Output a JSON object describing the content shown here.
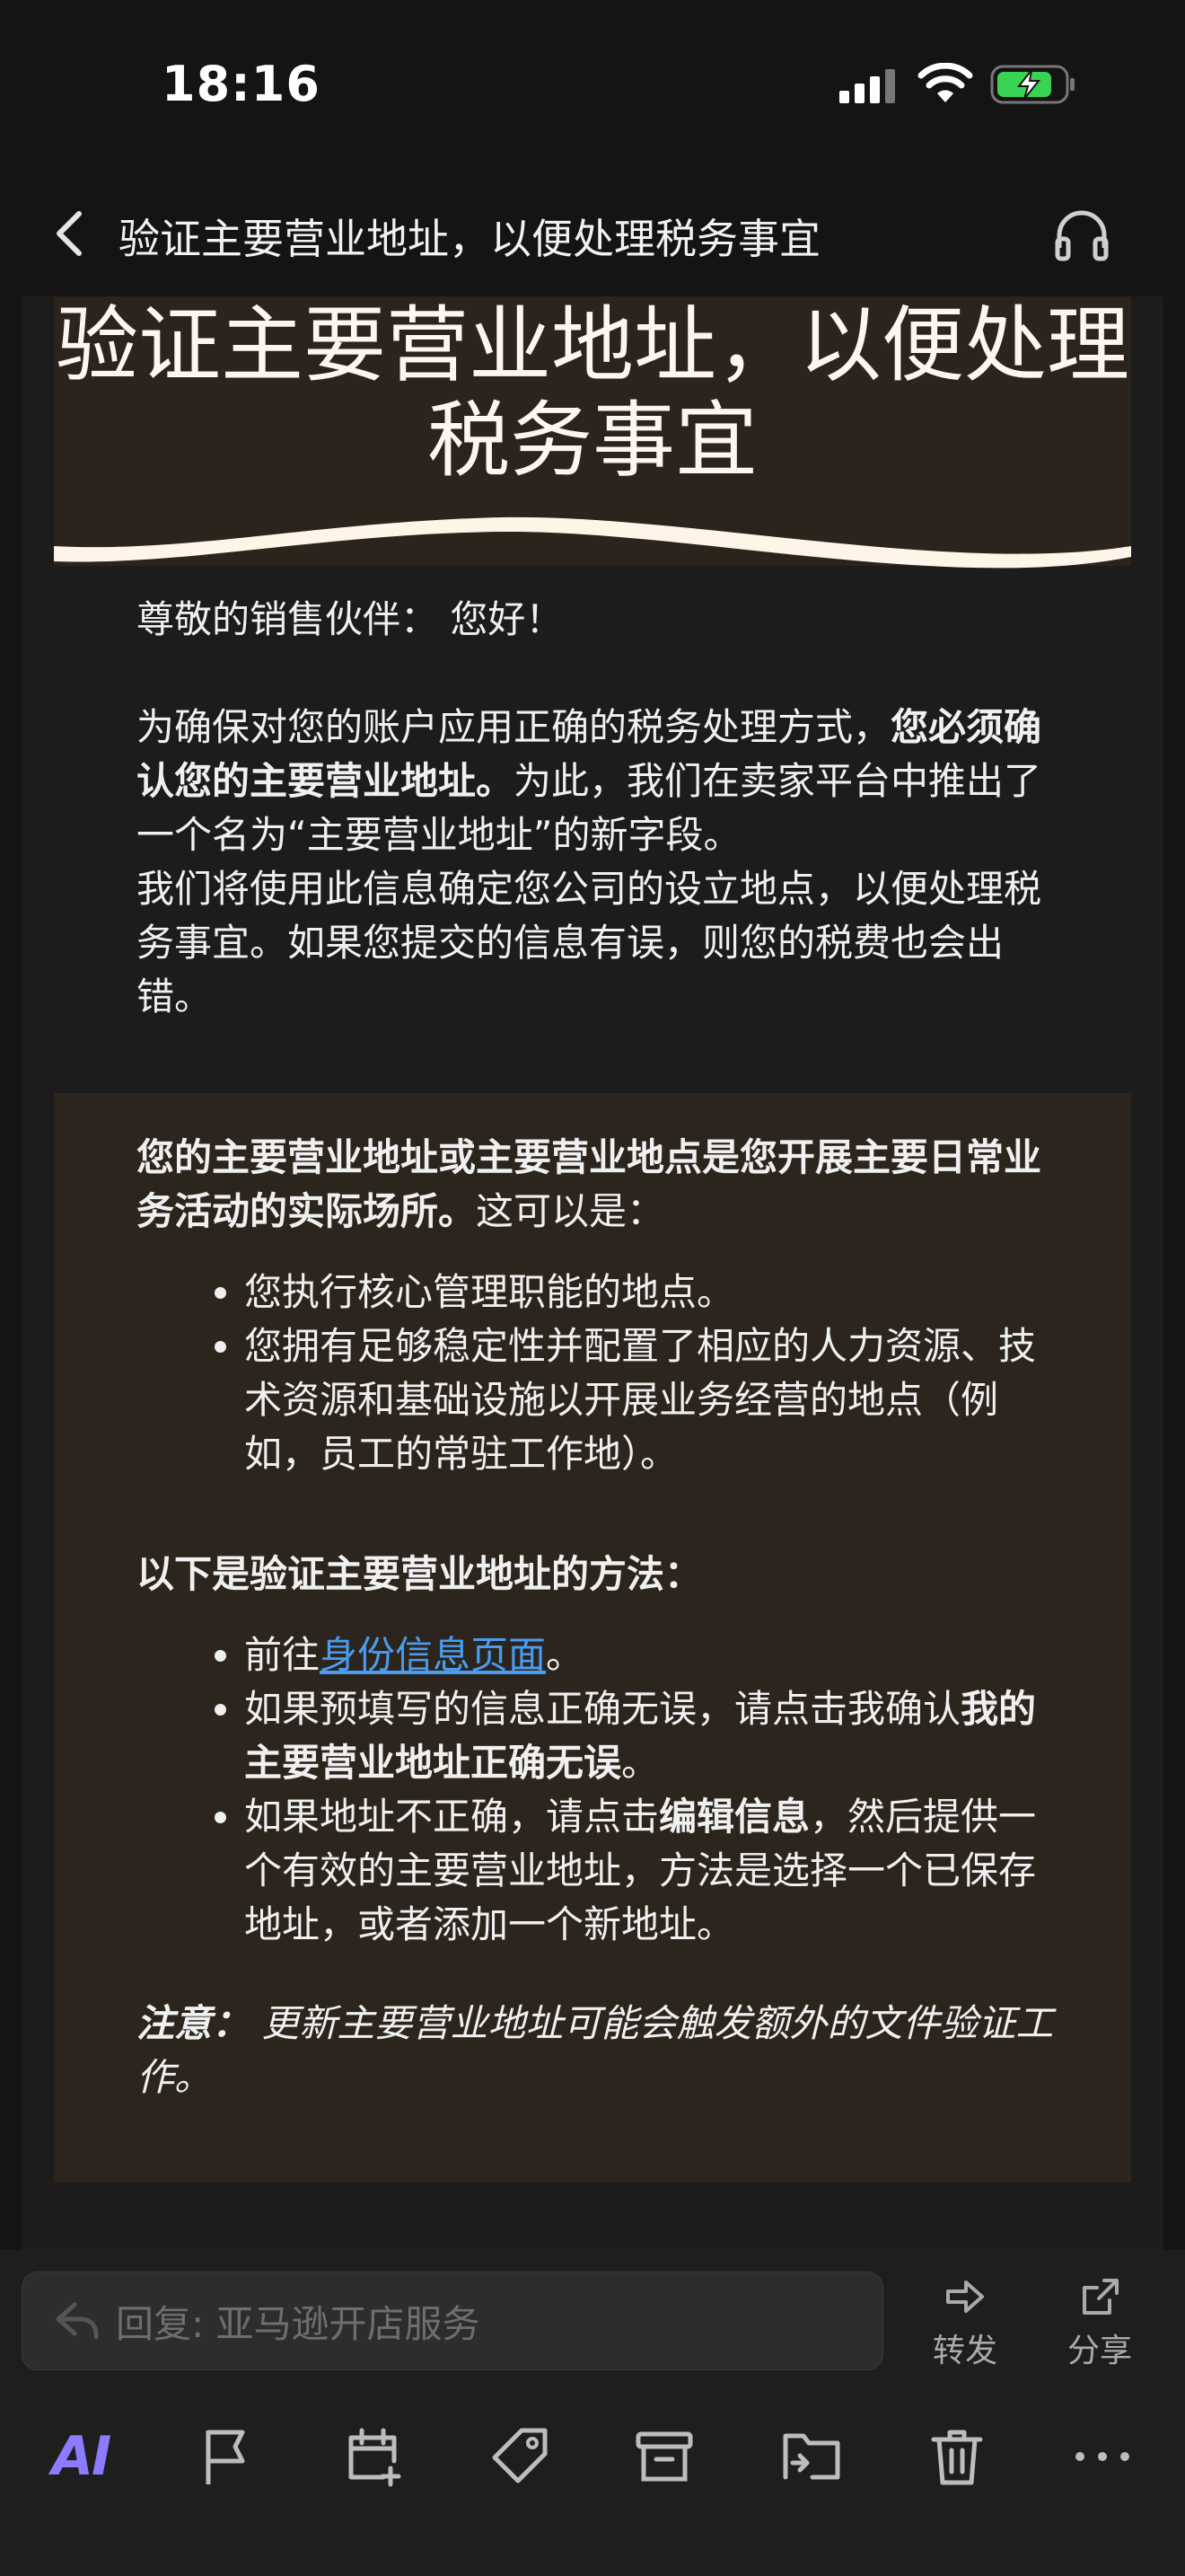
{
  "status": {
    "time": "18:16"
  },
  "nav": {
    "title": "验证主要营业地址，以便处理税务事宜"
  },
  "email": {
    "hero_title": "验证主要营业地址，以便处理税务事宜",
    "greeting": "尊敬的销售伙伴：  您好！",
    "intro_before_bold": "为确保对您的账户应用正确的税务处理方式，",
    "intro_bold": "您必须确认您的主要营业地址。",
    "intro_after_bold": "为此，我们在卖家平台中推出了一个名为“主要营业地址”的新字段。",
    "intro_line2": "我们将使用此信息确定您公司的设立地点，以便处理税务事宜。如果您提交的信息有误，则您的税费也会出错。",
    "def_bold": "您的主要营业地址或主要营业地点是您开展主要日常业务活动的实际场所。",
    "def_after": "这可以是：",
    "def_items": [
      "您执行核心管理职能的地点。",
      "您拥有足够稳定性并配置了相应的人力资源、技术资源和基础设施以开展业务经营的地点（例如，员工的常驻工作地）。"
    ],
    "method_heading": "以下是验证主要营业地址的方法：",
    "step1_before": "前往",
    "step1_link": "身份信息页面",
    "step1_after": "。",
    "step2_before": "如果预填写的信息正确无误，请点击我确认",
    "step2_bold": "我的主要营业地址正确无误",
    "step2_after": "。",
    "step3_before": "如果地址不正确，请点击",
    "step3_bold": "编辑信息",
    "step3_after": "，然后提供一个有效的主要营业地址，方法是选择一个已保存地址，或者添加一个新地址。",
    "note_label": "注意：",
    "note_text": " 更新主要营业地址可能会触发额外的文件验证工作。"
  },
  "reply": {
    "placeholder": "回复: 亚马逊开店服务"
  },
  "actions": {
    "forward": "转发",
    "share": "分享"
  },
  "toolbar": {
    "ai_label": "AI"
  },
  "colors": {
    "accent": "#8a7bff",
    "link": "#4a9cf0",
    "hero_bg": "#2a241c",
    "box_bg": "#2b251d"
  }
}
